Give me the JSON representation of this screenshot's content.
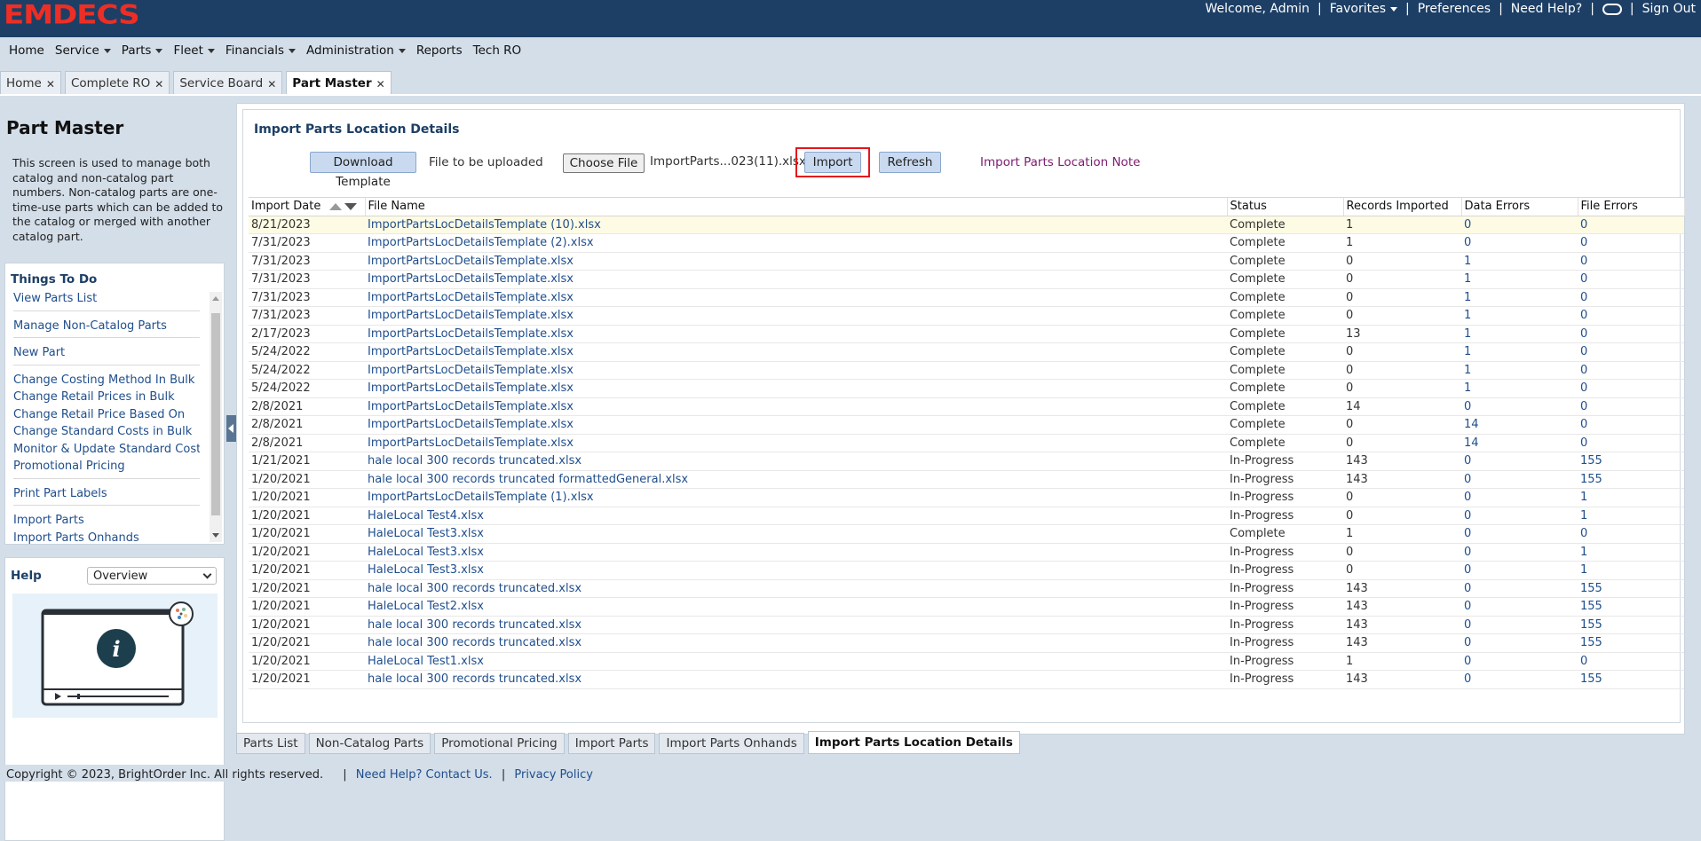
{
  "header": {
    "logo": "EMDECS",
    "welcome": "Welcome, Admin",
    "favorites": "Favorites",
    "preferences": "Preferences",
    "need_help": "Need Help?",
    "sign_out": "Sign Out"
  },
  "nav": {
    "items": [
      {
        "label": "Home",
        "dropdown": false
      },
      {
        "label": "Service",
        "dropdown": true
      },
      {
        "label": "Parts",
        "dropdown": true
      },
      {
        "label": "Fleet",
        "dropdown": true
      },
      {
        "label": "Financials",
        "dropdown": true
      },
      {
        "label": "Administration",
        "dropdown": true
      },
      {
        "label": "Reports",
        "dropdown": false
      },
      {
        "label": "Tech RO",
        "dropdown": false
      }
    ]
  },
  "tabs": [
    {
      "label": "Home",
      "active": false
    },
    {
      "label": "Complete RO",
      "active": false
    },
    {
      "label": "Service Board",
      "active": false
    },
    {
      "label": "Part Master",
      "active": true
    }
  ],
  "left": {
    "title": "Part Master",
    "description": "This screen is used to manage both catalog and non-catalog part numbers. Non-catalog parts are one-time-use parts which can be added to the catalog or merged with another catalog part.",
    "todo_title": "Things To Do",
    "todo_groups": [
      [
        "View Parts List"
      ],
      [
        "Manage Non-Catalog Parts"
      ],
      [
        "New Part"
      ],
      [
        "Change Costing Method In Bulk",
        "Change Retail Prices in Bulk",
        "Change Retail Price Based On",
        "Change Standard Costs in Bulk",
        "Monitor & Update Standard Costs",
        "Promotional Pricing"
      ],
      [
        "Print Part Labels"
      ],
      [
        "Import Parts",
        "Import Parts Onhands"
      ]
    ],
    "help_title": "Help",
    "help_option": "Overview"
  },
  "main": {
    "section_title": "Import Parts Location Details",
    "download_template": "Download Template",
    "file_label": "File to be uploaded",
    "choose_file": "Choose File",
    "file_name": "ImportParts...023(11).xlsx",
    "import": "Import",
    "refresh": "Refresh",
    "note_link": "Import Parts Location Note"
  },
  "table": {
    "columns": [
      "Import Date",
      "File Name",
      "Status",
      "Records Imported",
      "Data Errors",
      "File Errors"
    ],
    "rows": [
      [
        "8/21/2023",
        "ImportPartsLocDetailsTemplate (10).xlsx",
        "Complete",
        "1",
        "0",
        "0"
      ],
      [
        "7/31/2023",
        "ImportPartsLocDetailsTemplate (2).xlsx",
        "Complete",
        "1",
        "0",
        "0"
      ],
      [
        "7/31/2023",
        "ImportPartsLocDetailsTemplate.xlsx",
        "Complete",
        "0",
        "1",
        "0"
      ],
      [
        "7/31/2023",
        "ImportPartsLocDetailsTemplate.xlsx",
        "Complete",
        "0",
        "1",
        "0"
      ],
      [
        "7/31/2023",
        "ImportPartsLocDetailsTemplate.xlsx",
        "Complete",
        "0",
        "1",
        "0"
      ],
      [
        "7/31/2023",
        "ImportPartsLocDetailsTemplate.xlsx",
        "Complete",
        "0",
        "1",
        "0"
      ],
      [
        "2/17/2023",
        "ImportPartsLocDetailsTemplate.xlsx",
        "Complete",
        "13",
        "1",
        "0"
      ],
      [
        "5/24/2022",
        "ImportPartsLocDetailsTemplate.xlsx",
        "Complete",
        "0",
        "1",
        "0"
      ],
      [
        "5/24/2022",
        "ImportPartsLocDetailsTemplate.xlsx",
        "Complete",
        "0",
        "1",
        "0"
      ],
      [
        "5/24/2022",
        "ImportPartsLocDetailsTemplate.xlsx",
        "Complete",
        "0",
        "1",
        "0"
      ],
      [
        "2/8/2021",
        "ImportPartsLocDetailsTemplate.xlsx",
        "Complete",
        "14",
        "0",
        "0"
      ],
      [
        "2/8/2021",
        "ImportPartsLocDetailsTemplate.xlsx",
        "Complete",
        "0",
        "14",
        "0"
      ],
      [
        "2/8/2021",
        "ImportPartsLocDetailsTemplate.xlsx",
        "Complete",
        "0",
        "14",
        "0"
      ],
      [
        "1/21/2021",
        "hale local 300 records truncated.xlsx",
        "In-Progress",
        "143",
        "0",
        "155"
      ],
      [
        "1/20/2021",
        "hale local 300 records truncated formattedGeneral.xlsx",
        "In-Progress",
        "143",
        "0",
        "155"
      ],
      [
        "1/20/2021",
        "ImportPartsLocDetailsTemplate (1).xlsx",
        "In-Progress",
        "0",
        "0",
        "1"
      ],
      [
        "1/20/2021",
        "HaleLocal Test4.xlsx",
        "In-Progress",
        "0",
        "0",
        "1"
      ],
      [
        "1/20/2021",
        "HaleLocal Test3.xlsx",
        "Complete",
        "1",
        "0",
        "0"
      ],
      [
        "1/20/2021",
        "HaleLocal Test3.xlsx",
        "In-Progress",
        "0",
        "0",
        "1"
      ],
      [
        "1/20/2021",
        "HaleLocal Test3.xlsx",
        "In-Progress",
        "0",
        "0",
        "1"
      ],
      [
        "1/20/2021",
        "hale local 300 records truncated.xlsx",
        "In-Progress",
        "143",
        "0",
        "155"
      ],
      [
        "1/20/2021",
        "HaleLocal Test2.xlsx",
        "In-Progress",
        "143",
        "0",
        "155"
      ],
      [
        "1/20/2021",
        "hale local 300 records truncated.xlsx",
        "In-Progress",
        "143",
        "0",
        "155"
      ],
      [
        "1/20/2021",
        "hale local 300 records truncated.xlsx",
        "In-Progress",
        "143",
        "0",
        "155"
      ],
      [
        "1/20/2021",
        "HaleLocal Test1.xlsx",
        "In-Progress",
        "1",
        "0",
        "0"
      ],
      [
        "1/20/2021",
        "hale local 300 records truncated.xlsx",
        "In-Progress",
        "143",
        "0",
        "155"
      ]
    ]
  },
  "bottom_tabs": [
    {
      "label": "Parts List",
      "active": false
    },
    {
      "label": "Non-Catalog Parts",
      "active": false
    },
    {
      "label": "Promotional Pricing",
      "active": false
    },
    {
      "label": "Import Parts",
      "active": false
    },
    {
      "label": "Import Parts Onhands",
      "active": false
    },
    {
      "label": "Import Parts Location Details",
      "active": true
    }
  ],
  "footer": {
    "copyright": "Copyright © 2023, BrightOrder Inc. All rights reserved.",
    "contact": "Need Help? Contact Us.",
    "privacy": "Privacy Policy"
  },
  "colors": {
    "header_bg": "#1d3f66",
    "logo": "#ee2e24",
    "link": "#1f4e8c",
    "highlight_border": "#e5151c",
    "note_link": "#7b1c6f"
  }
}
